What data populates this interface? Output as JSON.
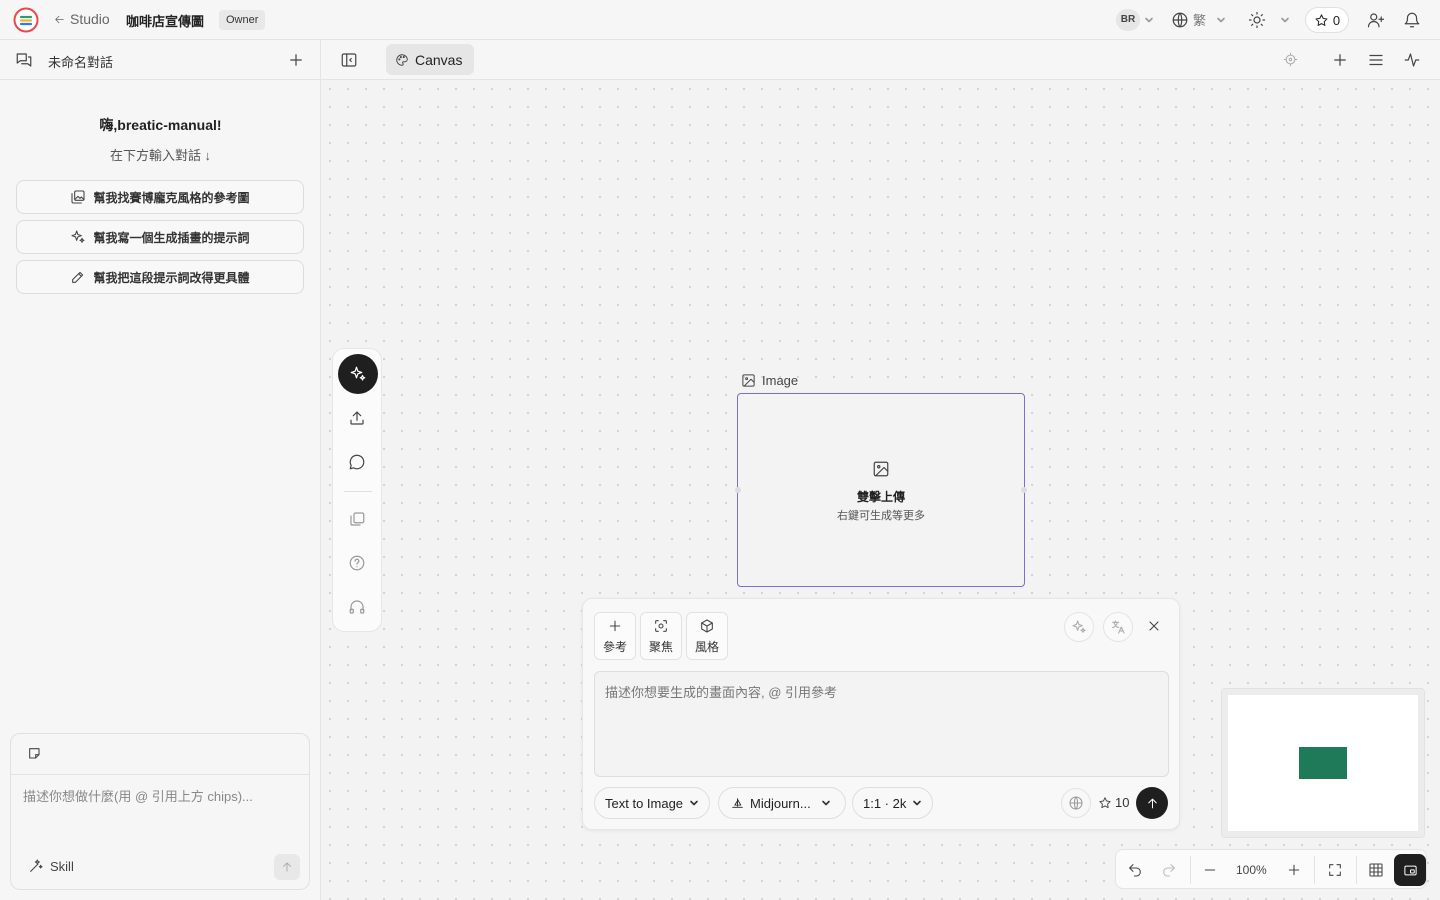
{
  "header": {
    "back_label": "Studio",
    "project_title": "咖啡店宣傳圖",
    "role_badge": "Owner",
    "avatar_initials": "BR",
    "language_label": "繁",
    "credits": "0"
  },
  "sidebar": {
    "chat_title": "未命名對話",
    "greeting": "嗨,breatic-manual!",
    "hint": "在下方輸入對話 ↓",
    "suggestions": [
      {
        "label": "幫我找賽博龐克風格的參考圖",
        "icon": "gallery-icon"
      },
      {
        "label": "幫我寫一個生成插畫的提示詞",
        "icon": "sparkles-icon"
      },
      {
        "label": "幫我把這段提示詞改得更具體",
        "icon": "pencil-icon"
      }
    ],
    "input_placeholder": "描述你想做什麼(用 @ 引用上方 chips)...",
    "skill_label": "Skill"
  },
  "canvas_header": {
    "tab_label": "Canvas"
  },
  "node": {
    "label": "Image",
    "upload_title": "雙擊上傳",
    "upload_subtitle": "右鍵可生成等更多"
  },
  "generator": {
    "chips": [
      {
        "label": "參考",
        "icon": "plus-icon"
      },
      {
        "label": "聚焦",
        "icon": "focus-icon"
      },
      {
        "label": "風格",
        "icon": "cube-icon"
      }
    ],
    "prompt_placeholder": "描述你想要生成的畫面內容, @ 引用參考",
    "mode_label": "Text to Image",
    "model_label": "Midjourn...",
    "ratio_label": "1:1 · 2k",
    "cost": "10"
  },
  "zoom": {
    "level": "100%"
  },
  "colors": {
    "accent_node_border": "#7b6fd6",
    "minimap_node": "#1f7a5a",
    "dark_button": "#1f1f1f"
  }
}
